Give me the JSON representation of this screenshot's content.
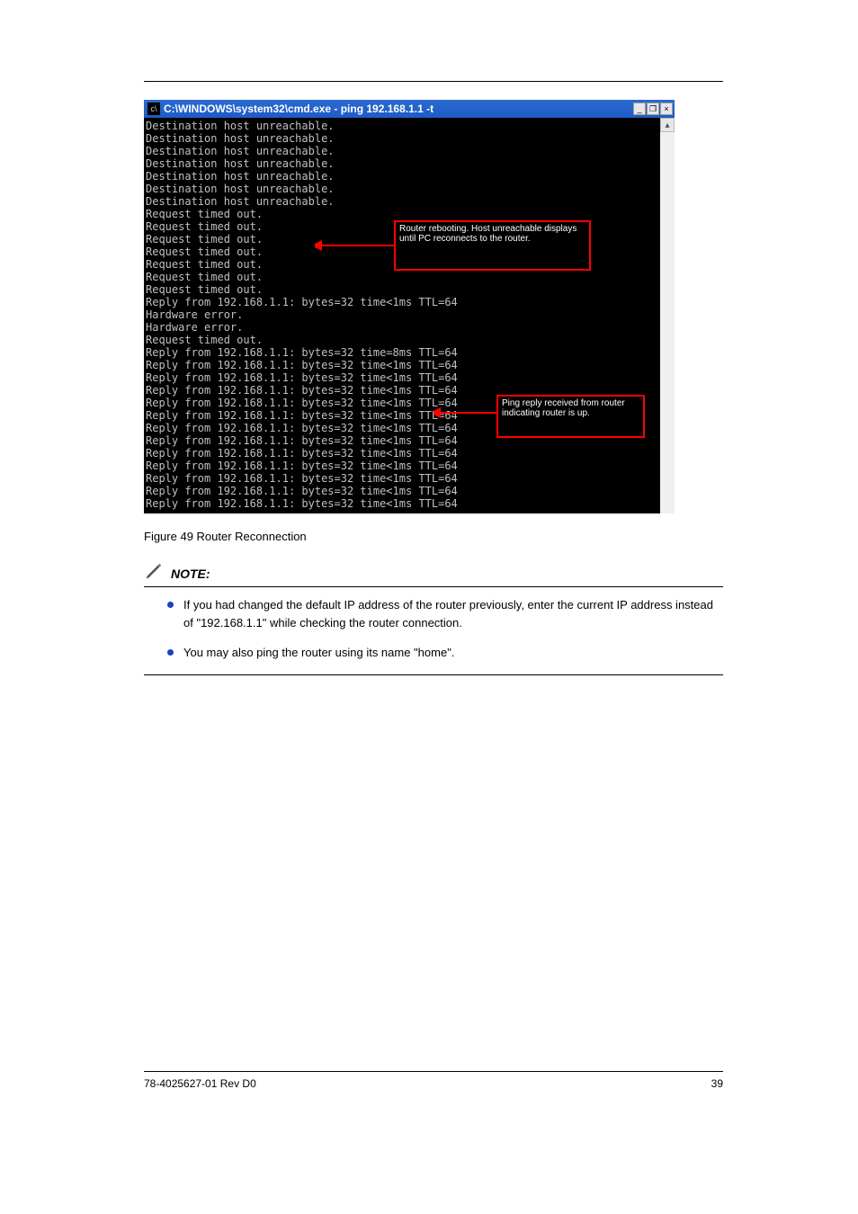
{
  "cmd": {
    "title": "C:\\WINDOWS\\system32\\cmd.exe - ping 192.168.1.1 -t",
    "lines": [
      "Destination host unreachable.",
      "Destination host unreachable.",
      "Destination host unreachable.",
      "Destination host unreachable.",
      "Destination host unreachable.",
      "Destination host unreachable.",
      "Destination host unreachable.",
      "Request timed out.",
      "Request timed out.",
      "Request timed out.",
      "Request timed out.",
      "Request timed out.",
      "Request timed out.",
      "Request timed out.",
      "Reply from 192.168.1.1: bytes=32 time<1ms TTL=64",
      "Hardware error.",
      "Hardware error.",
      "Request timed out.",
      "Reply from 192.168.1.1: bytes=32 time=8ms TTL=64",
      "Reply from 192.168.1.1: bytes=32 time<1ms TTL=64",
      "Reply from 192.168.1.1: bytes=32 time<1ms TTL=64",
      "Reply from 192.168.1.1: bytes=32 time<1ms TTL=64",
      "Reply from 192.168.1.1: bytes=32 time<1ms TTL=64",
      "Reply from 192.168.1.1: bytes=32 time<1ms TTL=64",
      "Reply from 192.168.1.1: bytes=32 time<1ms TTL=64",
      "Reply from 192.168.1.1: bytes=32 time<1ms TTL=64",
      "Reply from 192.168.1.1: bytes=32 time<1ms TTL=64",
      "Reply from 192.168.1.1: bytes=32 time<1ms TTL=64",
      "Reply from 192.168.1.1: bytes=32 time<1ms TTL=64",
      "Reply from 192.168.1.1: bytes=32 time<1ms TTL=64",
      "Reply from 192.168.1.1: bytes=32 time<1ms TTL=64"
    ]
  },
  "callouts": {
    "top": "Router rebooting. Host unreachable displays until PC reconnects to the router.",
    "bottom": "Ping reply received from router indicating router is up."
  },
  "figure_caption": "Figure 49 Router Reconnection",
  "note": {
    "heading": "NOTE:",
    "items": [
      "If you had changed the default IP address of the router previously, enter the current IP address instead of \"192.168.1.1\" while checking the router connection.",
      "You may also ping the router using its name \"home\"."
    ]
  },
  "footer": {
    "left": "78-4025627-01 Rev D0",
    "right": "39"
  }
}
